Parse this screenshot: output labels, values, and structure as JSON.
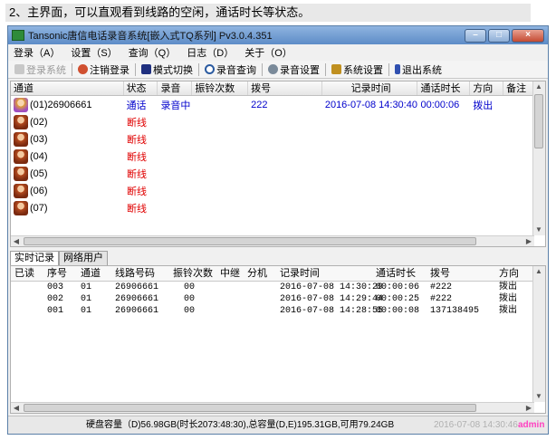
{
  "caption": "2、主界面，可以直观看到线路的空闲，通话时长等状态。",
  "window": {
    "title": "Tansonic唐信电话录音系统[嵌入式TQ系列] Pv3.0.4.351",
    "controls": {
      "minimize": "–",
      "maximize": "□",
      "close": "×"
    }
  },
  "menu": [
    "登录（A）",
    "设置（S）",
    "查询（Q）",
    "日志（D）",
    "关于（O）"
  ],
  "toolbar": {
    "login": "登录系统",
    "logout": "注销登录",
    "mode": "模式切换",
    "record_query": "录音查询",
    "record_settings": "录音设置",
    "system_settings": "系统设置",
    "exit": "退出系统"
  },
  "channel_table": {
    "headers": [
      "通道",
      "状态",
      "录音",
      "振铃次数",
      "拨号",
      "记录时间",
      "通话时长",
      "方向",
      "备注"
    ],
    "rows": [
      {
        "channel": "(01)26906661",
        "status": "通话",
        "record": "录音中",
        "ring": "",
        "dial": "222",
        "time": "2016-07-08 14:30:40",
        "duration": "00:00:06",
        "direction": "拨出",
        "note": ""
      },
      {
        "channel": "(02)",
        "status": "断线"
      },
      {
        "channel": "(03)",
        "status": "断线"
      },
      {
        "channel": "(04)",
        "status": "断线"
      },
      {
        "channel": "(05)",
        "status": "断线"
      },
      {
        "channel": "(06)",
        "status": "断线"
      },
      {
        "channel": "(07)",
        "status": "断线"
      }
    ]
  },
  "tabs": [
    "实时记录",
    "网络用户"
  ],
  "log_table": {
    "headers": [
      "已读",
      "序号",
      "通道",
      "线路号码",
      "振铃次数",
      "中继",
      "分机",
      "记录时间",
      "通话时长",
      "拨号",
      "方向"
    ],
    "rows": [
      {
        "read": "",
        "seq": "003",
        "ch": "01",
        "number": "26906661",
        "ring": "00",
        "relay": "",
        "ext": "",
        "time": "2016-07-08 14:30:29",
        "duration": "00:00:06",
        "dial": "#222",
        "direction": "拨出"
      },
      {
        "read": "",
        "seq": "002",
        "ch": "01",
        "number": "26906661",
        "ring": "00",
        "relay": "",
        "ext": "",
        "time": "2016-07-08 14:29:44",
        "duration": "00:00:25",
        "dial": "#222",
        "direction": "拨出"
      },
      {
        "read": "",
        "seq": "001",
        "ch": "01",
        "number": "26906661",
        "ring": "00",
        "relay": "",
        "ext": "",
        "time": "2016-07-08 14:28:55",
        "duration": "00:00:08",
        "dial": "137138495",
        "direction": "拨出"
      }
    ]
  },
  "status": {
    "disk": "硬盘容量（D)56.98GB(时长2073:48:30),总容量(D,E)195.31GB,可用79.24GB",
    "clock": "2016-07-08 14:30:46",
    "user": "admin"
  },
  "colors": {
    "disconnected": "#e00000",
    "active": "#0000cc",
    "titlebar": "#5d8cc7"
  }
}
